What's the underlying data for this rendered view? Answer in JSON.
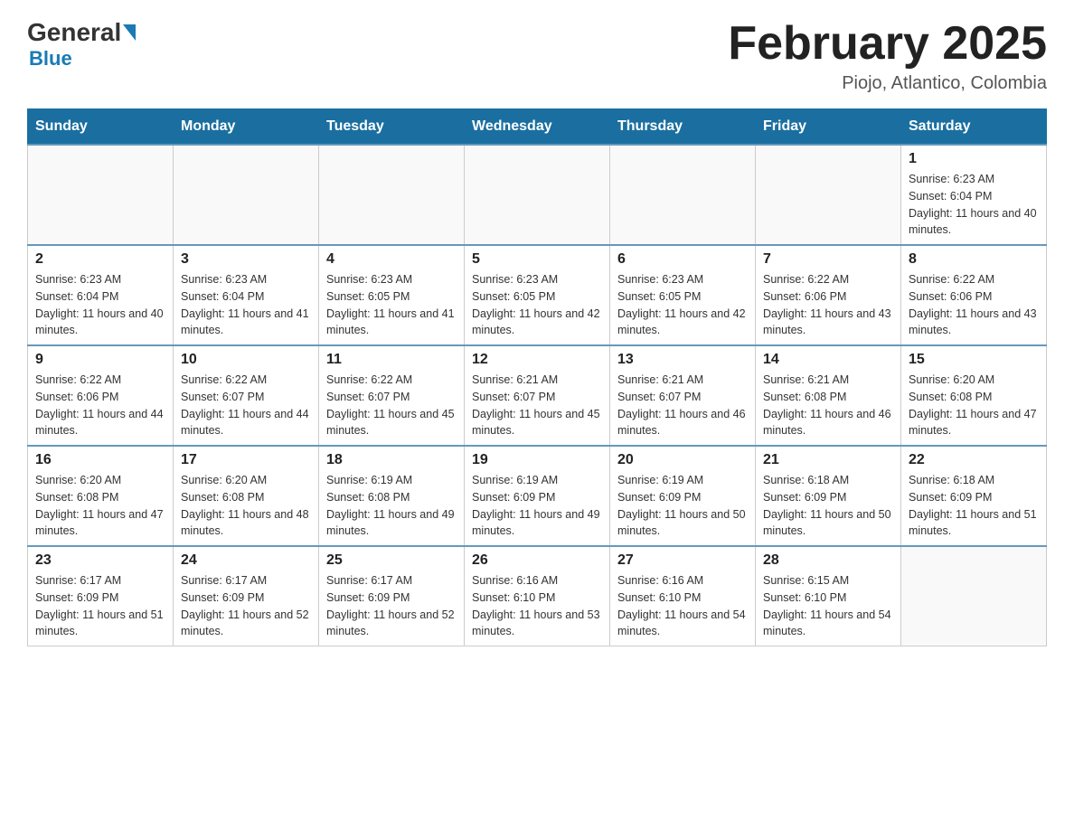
{
  "header": {
    "logo_general": "General",
    "logo_blue": "Blue",
    "month_title": "February 2025",
    "location": "Piojo, Atlantico, Colombia"
  },
  "days_of_week": [
    "Sunday",
    "Monday",
    "Tuesday",
    "Wednesday",
    "Thursday",
    "Friday",
    "Saturday"
  ],
  "weeks": [
    [
      {
        "day": "",
        "sunrise": "",
        "sunset": "",
        "daylight": ""
      },
      {
        "day": "",
        "sunrise": "",
        "sunset": "",
        "daylight": ""
      },
      {
        "day": "",
        "sunrise": "",
        "sunset": "",
        "daylight": ""
      },
      {
        "day": "",
        "sunrise": "",
        "sunset": "",
        "daylight": ""
      },
      {
        "day": "",
        "sunrise": "",
        "sunset": "",
        "daylight": ""
      },
      {
        "day": "",
        "sunrise": "",
        "sunset": "",
        "daylight": ""
      },
      {
        "day": "1",
        "sunrise": "Sunrise: 6:23 AM",
        "sunset": "Sunset: 6:04 PM",
        "daylight": "Daylight: 11 hours and 40 minutes."
      }
    ],
    [
      {
        "day": "2",
        "sunrise": "Sunrise: 6:23 AM",
        "sunset": "Sunset: 6:04 PM",
        "daylight": "Daylight: 11 hours and 40 minutes."
      },
      {
        "day": "3",
        "sunrise": "Sunrise: 6:23 AM",
        "sunset": "Sunset: 6:04 PM",
        "daylight": "Daylight: 11 hours and 41 minutes."
      },
      {
        "day": "4",
        "sunrise": "Sunrise: 6:23 AM",
        "sunset": "Sunset: 6:05 PM",
        "daylight": "Daylight: 11 hours and 41 minutes."
      },
      {
        "day": "5",
        "sunrise": "Sunrise: 6:23 AM",
        "sunset": "Sunset: 6:05 PM",
        "daylight": "Daylight: 11 hours and 42 minutes."
      },
      {
        "day": "6",
        "sunrise": "Sunrise: 6:23 AM",
        "sunset": "Sunset: 6:05 PM",
        "daylight": "Daylight: 11 hours and 42 minutes."
      },
      {
        "day": "7",
        "sunrise": "Sunrise: 6:22 AM",
        "sunset": "Sunset: 6:06 PM",
        "daylight": "Daylight: 11 hours and 43 minutes."
      },
      {
        "day": "8",
        "sunrise": "Sunrise: 6:22 AM",
        "sunset": "Sunset: 6:06 PM",
        "daylight": "Daylight: 11 hours and 43 minutes."
      }
    ],
    [
      {
        "day": "9",
        "sunrise": "Sunrise: 6:22 AM",
        "sunset": "Sunset: 6:06 PM",
        "daylight": "Daylight: 11 hours and 44 minutes."
      },
      {
        "day": "10",
        "sunrise": "Sunrise: 6:22 AM",
        "sunset": "Sunset: 6:07 PM",
        "daylight": "Daylight: 11 hours and 44 minutes."
      },
      {
        "day": "11",
        "sunrise": "Sunrise: 6:22 AM",
        "sunset": "Sunset: 6:07 PM",
        "daylight": "Daylight: 11 hours and 45 minutes."
      },
      {
        "day": "12",
        "sunrise": "Sunrise: 6:21 AM",
        "sunset": "Sunset: 6:07 PM",
        "daylight": "Daylight: 11 hours and 45 minutes."
      },
      {
        "day": "13",
        "sunrise": "Sunrise: 6:21 AM",
        "sunset": "Sunset: 6:07 PM",
        "daylight": "Daylight: 11 hours and 46 minutes."
      },
      {
        "day": "14",
        "sunrise": "Sunrise: 6:21 AM",
        "sunset": "Sunset: 6:08 PM",
        "daylight": "Daylight: 11 hours and 46 minutes."
      },
      {
        "day": "15",
        "sunrise": "Sunrise: 6:20 AM",
        "sunset": "Sunset: 6:08 PM",
        "daylight": "Daylight: 11 hours and 47 minutes."
      }
    ],
    [
      {
        "day": "16",
        "sunrise": "Sunrise: 6:20 AM",
        "sunset": "Sunset: 6:08 PM",
        "daylight": "Daylight: 11 hours and 47 minutes."
      },
      {
        "day": "17",
        "sunrise": "Sunrise: 6:20 AM",
        "sunset": "Sunset: 6:08 PM",
        "daylight": "Daylight: 11 hours and 48 minutes."
      },
      {
        "day": "18",
        "sunrise": "Sunrise: 6:19 AM",
        "sunset": "Sunset: 6:08 PM",
        "daylight": "Daylight: 11 hours and 49 minutes."
      },
      {
        "day": "19",
        "sunrise": "Sunrise: 6:19 AM",
        "sunset": "Sunset: 6:09 PM",
        "daylight": "Daylight: 11 hours and 49 minutes."
      },
      {
        "day": "20",
        "sunrise": "Sunrise: 6:19 AM",
        "sunset": "Sunset: 6:09 PM",
        "daylight": "Daylight: 11 hours and 50 minutes."
      },
      {
        "day": "21",
        "sunrise": "Sunrise: 6:18 AM",
        "sunset": "Sunset: 6:09 PM",
        "daylight": "Daylight: 11 hours and 50 minutes."
      },
      {
        "day": "22",
        "sunrise": "Sunrise: 6:18 AM",
        "sunset": "Sunset: 6:09 PM",
        "daylight": "Daylight: 11 hours and 51 minutes."
      }
    ],
    [
      {
        "day": "23",
        "sunrise": "Sunrise: 6:17 AM",
        "sunset": "Sunset: 6:09 PM",
        "daylight": "Daylight: 11 hours and 51 minutes."
      },
      {
        "day": "24",
        "sunrise": "Sunrise: 6:17 AM",
        "sunset": "Sunset: 6:09 PM",
        "daylight": "Daylight: 11 hours and 52 minutes."
      },
      {
        "day": "25",
        "sunrise": "Sunrise: 6:17 AM",
        "sunset": "Sunset: 6:09 PM",
        "daylight": "Daylight: 11 hours and 52 minutes."
      },
      {
        "day": "26",
        "sunrise": "Sunrise: 6:16 AM",
        "sunset": "Sunset: 6:10 PM",
        "daylight": "Daylight: 11 hours and 53 minutes."
      },
      {
        "day": "27",
        "sunrise": "Sunrise: 6:16 AM",
        "sunset": "Sunset: 6:10 PM",
        "daylight": "Daylight: 11 hours and 54 minutes."
      },
      {
        "day": "28",
        "sunrise": "Sunrise: 6:15 AM",
        "sunset": "Sunset: 6:10 PM",
        "daylight": "Daylight: 11 hours and 54 minutes."
      },
      {
        "day": "",
        "sunrise": "",
        "sunset": "",
        "daylight": ""
      }
    ]
  ]
}
